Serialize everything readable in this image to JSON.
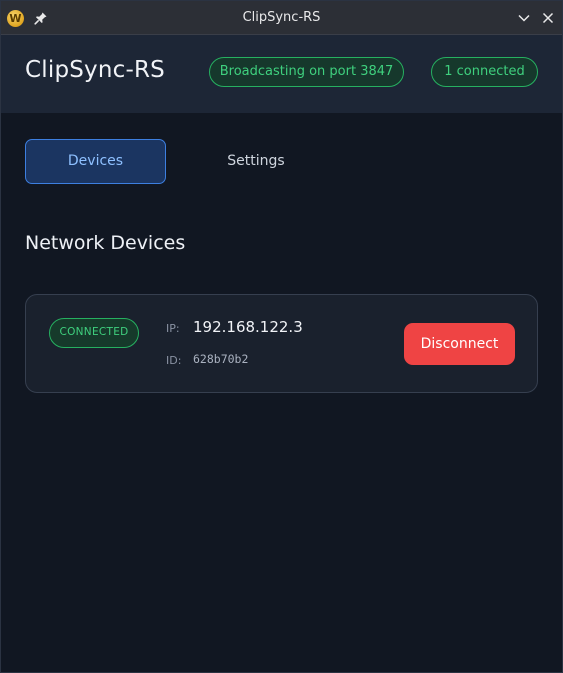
{
  "window": {
    "title": "ClipSync-RS",
    "app_icon_letter": "W",
    "icons": [
      "app-icon",
      "pin-icon",
      "chevron-down-icon",
      "close-icon"
    ]
  },
  "header": {
    "app_title": "ClipSync-RS",
    "broadcast_status": "Broadcasting on port 3847",
    "connection_count": "1 connected"
  },
  "tabs": [
    {
      "label": "Devices",
      "active": true
    },
    {
      "label": "Settings",
      "active": false
    }
  ],
  "devices_section": {
    "title": "Network Devices",
    "devices": [
      {
        "status": "CONNECTED",
        "ip_label": "IP:",
        "ip": "192.168.122.3",
        "id_label": "ID:",
        "id": "628b70b2",
        "action_label": "Disconnect"
      }
    ]
  },
  "colors": {
    "background": "#111722",
    "header": "#1d2636",
    "success": "#3fd07e",
    "accent_blue": "#3d7fe0",
    "danger": "#ef4444"
  }
}
